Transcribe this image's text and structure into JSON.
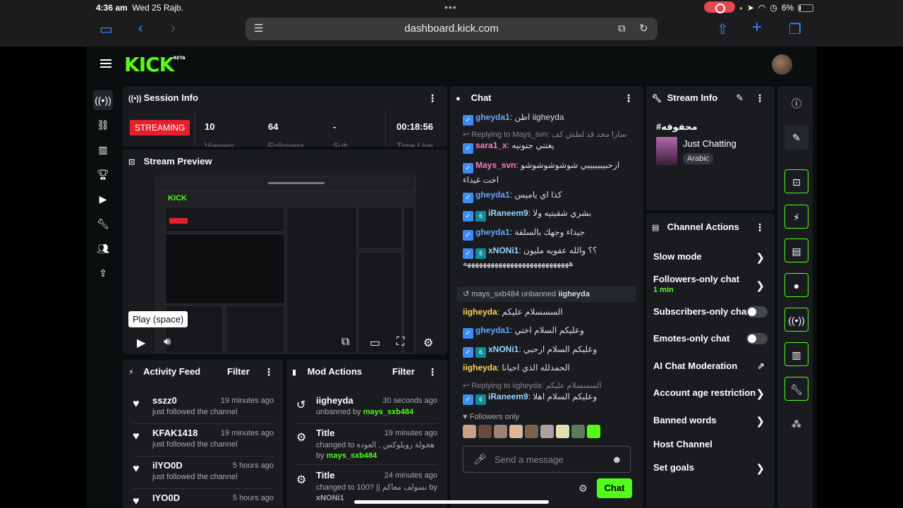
{
  "status": {
    "time": "4:36 am",
    "date": "Wed 25 Rajb.",
    "battery": "6%"
  },
  "browser": {
    "url": "dashboard.kick.com"
  },
  "brand": {
    "logo": "KICK",
    "beta": "BETA",
    "accent": "#53fc18"
  },
  "session": {
    "title": "Session Info",
    "status": "STREAMING",
    "stats": [
      {
        "value": "10",
        "label": "Viewers"
      },
      {
        "value": "64",
        "label": "Followers"
      },
      {
        "value": "-",
        "label": "Sub"
      },
      {
        "value": "00:18:56",
        "label": "Time Live"
      }
    ]
  },
  "preview": {
    "title": "Stream Preview",
    "tooltip": "Play (space)"
  },
  "activity": {
    "title": "Activity Feed",
    "filter": "Filter",
    "items": [
      {
        "name": "sszz0",
        "time": "19 minutes ago",
        "text": "just followed the channel"
      },
      {
        "name": "KFAK1418",
        "time": "19 minutes ago",
        "text": "just followed the channel"
      },
      {
        "name": "ilYO0D",
        "time": "5 hours ago",
        "text": "just followed the channel"
      },
      {
        "name": "IYO0D",
        "time": "5 hours ago",
        "text": ""
      }
    ]
  },
  "mod": {
    "title": "Mod Actions",
    "filter": "Filter",
    "items": [
      {
        "name": "iigheyda",
        "time": "30 seconds ago",
        "line1": "unbanned by",
        "user": "mays_sxb484",
        "line2": ""
      },
      {
        "name": "Title",
        "time": "19 minutes ago",
        "line1": "changed to هجولة روبلوكس , العوده",
        "user": "mays_sxb484",
        "line2": "by"
      },
      {
        "name": "Title",
        "time": "24 minutes ago",
        "line1": "changed to 100? || نسولف معاكم by",
        "user": "xNONi1",
        "line2": ""
      }
    ]
  },
  "chat": {
    "title": "Chat",
    "lines": [
      {
        "user": "gheyda1",
        "msg": "اظن iigheyda",
        "color": "blue"
      },
      {
        "reply": "Replying to Mays_svn: سارا محد قد لطش كف"
      },
      {
        "user": "sara1_x",
        "msg": "يعنني جنونيه",
        "color": "pink"
      },
      {
        "user": "Mays_svn",
        "msg": "ارحبيييييييي شوشوشوشوشو اخت غيداء",
        "color": "pink"
      },
      {
        "user": "gheyda1",
        "msg": "كذا اي ياميس",
        "color": "blue"
      },
      {
        "user": "iRaneem9",
        "msg": "بشري شقيتيه ولا",
        "color": "cyan"
      },
      {
        "user": "gheyda1",
        "msg": "جيداء وجهك بالسلقة",
        "color": "blue"
      },
      {
        "user": "xNONi1",
        "msg": "؟؟ والله عفويه مليون",
        "color": "cyan"
      },
      {
        "user": "",
        "msg": "هههههههههههههههههههههههههههه",
        "color": "white"
      }
    ],
    "system": {
      "actor": "mays_sxb484",
      "action": "unbanned",
      "target": "iigheyda"
    },
    "lines2": [
      {
        "user": "iigheyda",
        "msg": "السسسلام عليكم",
        "color": "yellow"
      },
      {
        "user": "gheyda1",
        "msg": "وعليكم السلام اختي",
        "color": "blue"
      },
      {
        "user": "xNONi1",
        "msg": "وعليكم السلام ارحبي",
        "color": "cyan"
      },
      {
        "user": "iigheyda",
        "msg": "الحمدلله الذي احيانا",
        "color": "yellow"
      },
      {
        "reply": "Replying to iigheyda: السسسلام عليكم"
      },
      {
        "user": "iRaneem9",
        "msg": "وعليكم السلام اهلا",
        "color": "cyan"
      }
    ],
    "followers_only": "Followers only",
    "placeholder": "Send a message",
    "send": "Chat"
  },
  "stream_info": {
    "title": "Stream Info",
    "stream_title": "#محفوفه",
    "category": "Just Chatting",
    "language": "Arabic"
  },
  "actions": {
    "title": "Channel Actions",
    "items": [
      {
        "label": "Slow mode",
        "sub": "",
        "kind": "chevron"
      },
      {
        "label": "Followers-only chat",
        "sub": "1 min",
        "kind": "chevron"
      },
      {
        "label": "Subscribers-only chat",
        "sub": "",
        "kind": "toggle"
      },
      {
        "label": "Emotes-only chat",
        "sub": "",
        "kind": "toggle"
      },
      {
        "label": "AI Chat Moderation",
        "sub": "",
        "kind": "external"
      },
      {
        "label": "Account age restriction",
        "sub": "",
        "kind": "chevron"
      },
      {
        "label": "Banned words",
        "sub": "",
        "kind": "chevron"
      },
      {
        "label": "Host Channel",
        "sub": "",
        "kind": "none"
      },
      {
        "label": "Set goals",
        "sub": "",
        "kind": "chevron"
      }
    ]
  }
}
